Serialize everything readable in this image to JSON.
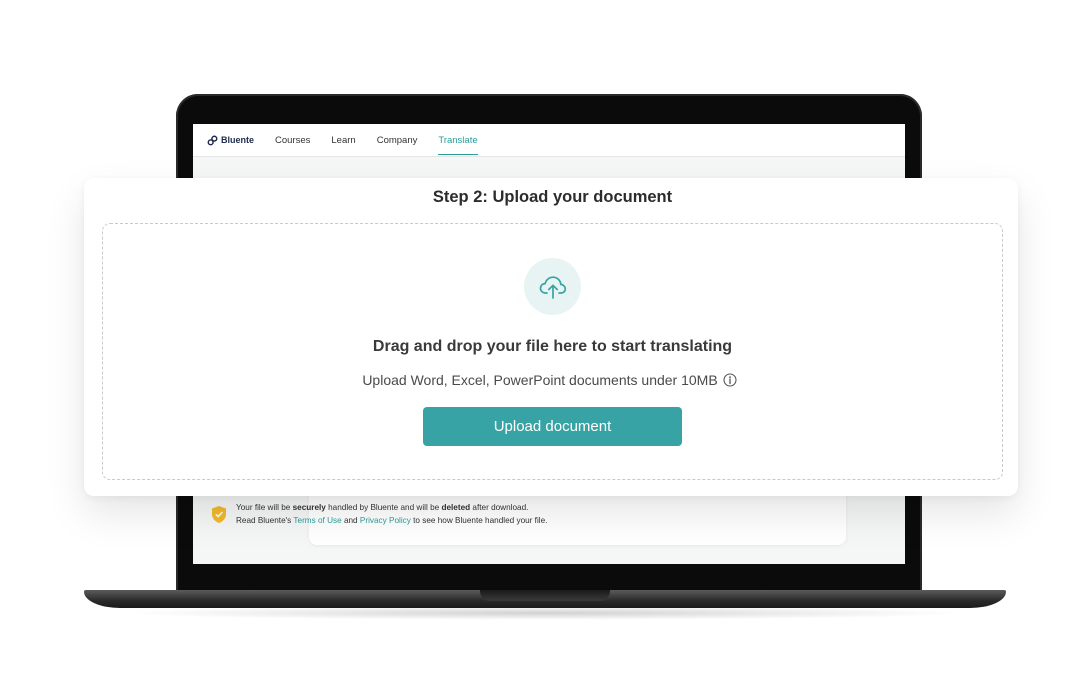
{
  "nav": {
    "brand": "Bluente",
    "links": [
      "Courses",
      "Learn",
      "Company",
      "Translate"
    ],
    "active": "Translate"
  },
  "upload": {
    "step_title": "Step 2: Upload your document",
    "drop_title": "Drag and drop your file here to start translating",
    "drop_subtitle": "Upload Word, Excel, PowerPoint documents under 10MB",
    "button_label": "Upload document"
  },
  "notice": {
    "line1_pre": "Your file will be",
    "line1_bold1": "securely",
    "line1_mid": "handled by Bluente and will be",
    "line1_bold2": "deleted",
    "line1_post": "after download.",
    "line2_pre": "Read Bluente's",
    "terms_link": "Terms of Use",
    "line2_and": "and",
    "privacy_link": "Privacy Policy",
    "line2_post": "to see how Bluente handled your file."
  },
  "colors": {
    "accent": "#38a3a5",
    "link": "#2a9d9b",
    "shield": "#f2b929"
  },
  "icons": {
    "brand": "link-chain-icon",
    "upload": "cloud-upload-icon",
    "info": "info-icon",
    "security": "shield-check-icon"
  }
}
